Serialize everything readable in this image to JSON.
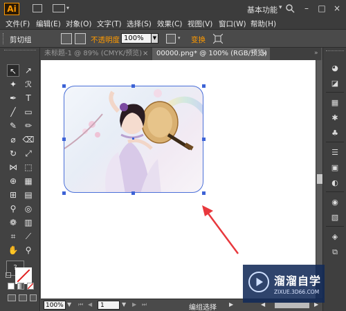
{
  "app": {
    "logo": "Ai",
    "workspace": "基本功能",
    "window_buttons": [
      "–",
      "□",
      "×"
    ]
  },
  "menu": [
    "文件(F)",
    "编辑(E)",
    "对象(O)",
    "文字(T)",
    "选择(S)",
    "效果(C)",
    "视图(V)",
    "窗口(W)",
    "帮助(H)"
  ],
  "control": {
    "selection_label": "剪切组",
    "opacity_label": "不透明度",
    "opacity_value": "100%",
    "transform_label": "变换"
  },
  "tabs": [
    {
      "label": "未标题-1 @ 89% (CMYK/预览)",
      "active": false
    },
    {
      "label": "00000.png* @ 100% (RGB/预览)",
      "active": true
    }
  ],
  "status": {
    "zoom": "100%",
    "page": "1",
    "tool_status": "编组选择"
  },
  "watermark": {
    "title": "溜溜自学",
    "url": "ZIXUE.3D66.COM"
  },
  "colors": {
    "accent": "#ff9a00",
    "selection_blue": "#3d63d6",
    "annotation_arrow": "#e8383d"
  }
}
